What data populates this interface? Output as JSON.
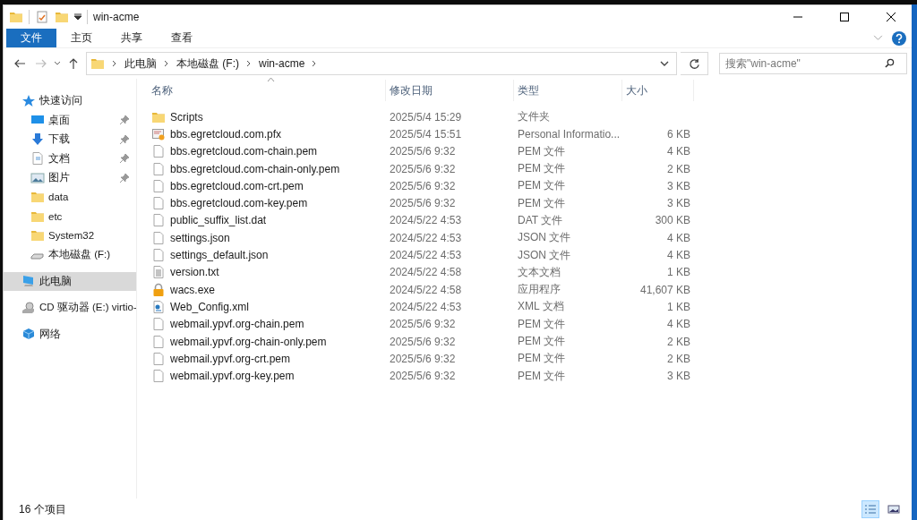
{
  "window": {
    "title": "win-acme"
  },
  "ribbon": {
    "tabs": [
      {
        "label": "文件",
        "kind": "file",
        "selected": false
      },
      {
        "label": "主页",
        "kind": "tab",
        "selected": false
      },
      {
        "label": "共享",
        "kind": "tab",
        "selected": false
      },
      {
        "label": "查看",
        "kind": "tab",
        "selected": false
      }
    ]
  },
  "address": {
    "crumbs": [
      "此电脑",
      "本地磁盘 (F:)",
      "win-acme"
    ],
    "search_placeholder": "搜索\"win-acme\""
  },
  "sidebar": {
    "items": [
      {
        "label": "快速访问",
        "kind": "star",
        "selected": false,
        "children": [
          {
            "label": "桌面",
            "kind": "desktop",
            "pinned": true,
            "selected": false
          },
          {
            "label": "下载",
            "kind": "download",
            "pinned": true,
            "selected": false
          },
          {
            "label": "文档",
            "kind": "document",
            "pinned": true,
            "selected": false
          },
          {
            "label": "图片",
            "kind": "pictures",
            "pinned": true,
            "selected": false
          },
          {
            "label": "data",
            "kind": "folder",
            "pinned": false,
            "selected": false
          },
          {
            "label": "etc",
            "kind": "folder",
            "pinned": false,
            "selected": false
          },
          {
            "label": "System32",
            "kind": "folder",
            "pinned": false,
            "selected": false
          },
          {
            "label": "本地磁盘 (F:)",
            "kind": "drive",
            "pinned": false,
            "selected": false
          }
        ]
      },
      {
        "label": "此电脑",
        "kind": "pc",
        "selected": true
      },
      {
        "label": "CD 驱动器 (E:) virtio-",
        "kind": "cd",
        "selected": false
      },
      {
        "label": "网络",
        "kind": "network",
        "selected": false
      }
    ]
  },
  "table": {
    "columns": [
      {
        "label": "名称",
        "sorted": true
      },
      {
        "label": "修改日期",
        "sorted": false
      },
      {
        "label": "类型",
        "sorted": false
      },
      {
        "label": "大小",
        "sorted": false
      }
    ],
    "rows": [
      {
        "kind": "folder",
        "name": "Scripts",
        "date": "2025/5/4 15:29",
        "type": "文件夹"
      },
      {
        "kind": "certificate",
        "name": "bbs.egretcloud.com.pfx",
        "date": "2025/5/4 15:51",
        "type": "Personal Informatio...",
        "size": "6 KB"
      },
      {
        "kind": "file",
        "name": "bbs.egretcloud.com-chain.pem",
        "date": "2025/5/6 9:32",
        "type": "PEM 文件",
        "size": "4 KB"
      },
      {
        "kind": "file",
        "name": "bbs.egretcloud.com-chain-only.pem",
        "date": "2025/5/6 9:32",
        "type": "PEM 文件",
        "size": "2 KB"
      },
      {
        "kind": "file",
        "name": "bbs.egretcloud.com-crt.pem",
        "date": "2025/5/6 9:32",
        "type": "PEM 文件",
        "size": "3 KB"
      },
      {
        "kind": "file",
        "name": "bbs.egretcloud.com-key.pem",
        "date": "2025/5/6 9:32",
        "type": "PEM 文件",
        "size": "3 KB"
      },
      {
        "kind": "file",
        "name": "public_suffix_list.dat",
        "date": "2024/5/22 4:53",
        "type": "DAT 文件",
        "size": "300 KB"
      },
      {
        "kind": "file",
        "name": "settings.json",
        "date": "2024/5/22 4:53",
        "type": "JSON 文件",
        "size": "4 KB"
      },
      {
        "kind": "file",
        "name": "settings_default.json",
        "date": "2024/5/22 4:53",
        "type": "JSON 文件",
        "size": "4 KB"
      },
      {
        "kind": "text",
        "name": "version.txt",
        "date": "2024/5/22 4:58",
        "type": "文本文档",
        "size": "1 KB"
      },
      {
        "kind": "lock",
        "name": "wacs.exe",
        "date": "2024/5/22 4:58",
        "type": "应用程序",
        "size": "41,607 KB"
      },
      {
        "kind": "xml",
        "name": "Web_Config.xml",
        "date": "2024/5/22 4:53",
        "type": "XML 文档",
        "size": "1 KB"
      },
      {
        "kind": "file",
        "name": "webmail.ypvf.org-chain.pem",
        "date": "2025/5/6 9:32",
        "type": "PEM 文件",
        "size": "4 KB"
      },
      {
        "kind": "file",
        "name": "webmail.ypvf.org-chain-only.pem",
        "date": "2025/5/6 9:32",
        "type": "PEM 文件",
        "size": "2 KB"
      },
      {
        "kind": "file",
        "name": "webmail.ypvf.org-crt.pem",
        "date": "2025/5/6 9:32",
        "type": "PEM 文件",
        "size": "2 KB"
      },
      {
        "kind": "file",
        "name": "webmail.ypvf.org-key.pem",
        "date": "2025/5/6 9:32",
        "type": "PEM 文件",
        "size": "3 KB"
      }
    ]
  },
  "status_bar": {
    "count": "16 个项目",
    "views": [
      {
        "kind": "details",
        "selected": true
      },
      {
        "kind": "large-icons",
        "selected": false
      }
    ]
  }
}
